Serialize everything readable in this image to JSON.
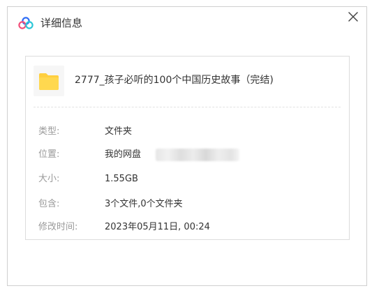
{
  "dialog": {
    "title": "详细信息",
    "close_label": "×"
  },
  "file": {
    "name": "2777_孩子必听的100个中国历史故事（完结)"
  },
  "details": {
    "type_label": "类型:",
    "type_value": "文件夹",
    "location_label": "位置:",
    "location_value": "我的网盘",
    "size_label": "大小:",
    "size_value": "1.55GB",
    "contains_label": "包含:",
    "contains_value": "3个文件,0个文件夹",
    "modified_label": "修改时间:",
    "modified_value": "2023年05月11日, 00:24"
  },
  "colors": {
    "cloud_blue": "#2f6df6",
    "cloud_pink": "#f2507a",
    "cloud_teal": "#2bc6d7",
    "folder_yellow": "#ffcf3f"
  },
  "icons": {
    "title_icon": "baidu-netdisk-logo-icon",
    "close_icon": "close-icon",
    "folder_icon": "folder-icon"
  }
}
